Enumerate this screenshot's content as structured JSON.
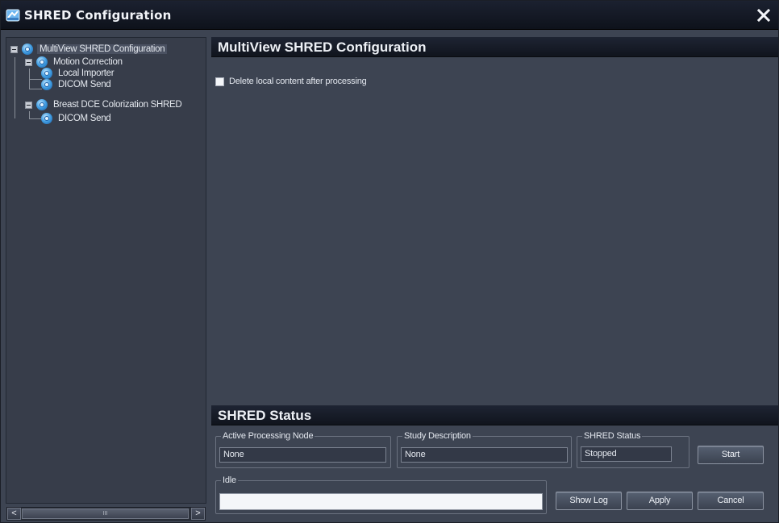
{
  "window": {
    "title": "SHRED Configuration",
    "title_icon": "shred-app-icon",
    "close_icon": "close-icon"
  },
  "tree": {
    "items": [
      {
        "label": "MultiView SHRED Configuration",
        "level": 0,
        "expanded": true,
        "selected": true
      },
      {
        "label": "Motion Correction",
        "level": 1,
        "expanded": true
      },
      {
        "label": "Local Importer",
        "level": 2
      },
      {
        "label": "DICOM Send",
        "level": 2
      },
      {
        "label": "Breast DCE Colorization SHRED",
        "level": 1,
        "expanded": true
      },
      {
        "label": "DICOM Send",
        "level": 2
      }
    ],
    "scrollbar": {
      "left_arrow": "<",
      "right_arrow": ">",
      "thumb_grip": "III"
    }
  },
  "config": {
    "title": "MultiView SHRED Configuration",
    "delete_checkbox_label": "Delete local content after processing",
    "delete_checked": false
  },
  "status": {
    "title": "SHRED Status",
    "active_node_label": "Active Processing Node",
    "active_node_value": "None",
    "study_label": "Study Description",
    "study_value": "None",
    "shred_status_label": "SHRED Status",
    "shred_status_value": "Stopped",
    "progress_label": "Idle",
    "progress_value": 0
  },
  "buttons": {
    "start": "Start",
    "show_log": "Show Log",
    "apply": "Apply",
    "cancel": "Cancel"
  },
  "colors": {
    "header_dark": "#10141d",
    "panel_bg": "#3d4452",
    "tree_bg": "#373d4a",
    "node_icon": "#3e9be0"
  }
}
